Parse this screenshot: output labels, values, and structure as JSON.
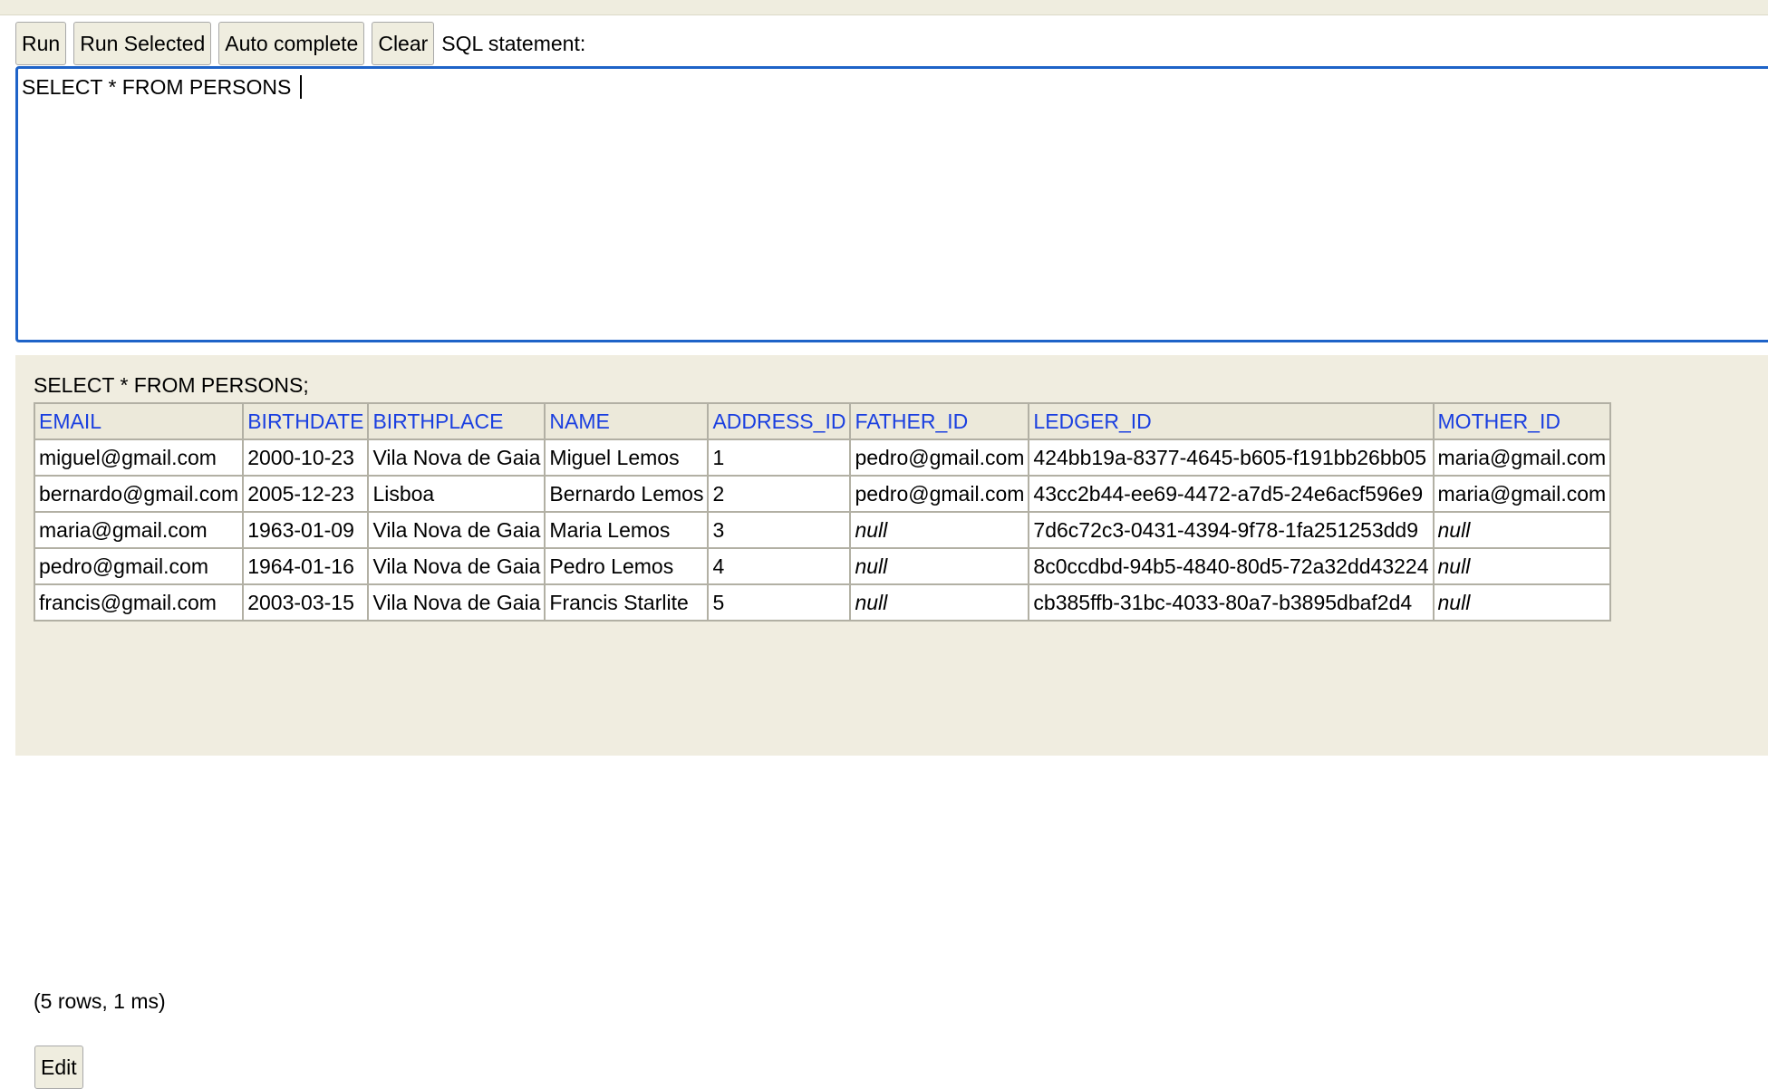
{
  "toolbar": {
    "run_label": "Run",
    "run_selected_label": "Run Selected",
    "auto_complete_label": "Auto complete",
    "clear_label": "Clear",
    "sql_statement_label": "SQL statement:"
  },
  "editor": {
    "value": "SELECT * FROM PERSONS "
  },
  "result": {
    "query_text": "SELECT * FROM PERSONS;",
    "columns": [
      "EMAIL",
      "BIRTHDATE",
      "BIRTHPLACE",
      "NAME",
      "ADDRESS_ID",
      "FATHER_ID",
      "LEDGER_ID",
      "MOTHER_ID"
    ],
    "rows": [
      [
        "miguel@gmail.com",
        "2000-10-23",
        "Vila Nova de Gaia",
        "Miguel Lemos",
        "1",
        "pedro@gmail.com",
        "424bb19a-8377-4645-b605-f191bb26bb05",
        "maria@gmail.com"
      ],
      [
        "bernardo@gmail.com",
        "2005-12-23",
        "Lisboa",
        "Bernardo Lemos",
        "2",
        "pedro@gmail.com",
        "43cc2b44-ee69-4472-a7d5-24e6acf596e9",
        "maria@gmail.com"
      ],
      [
        "maria@gmail.com",
        "1963-01-09",
        "Vila Nova de Gaia",
        "Maria Lemos",
        "3",
        "null",
        "7d6c72c3-0431-4394-9f78-1fa251253dd9",
        "null"
      ],
      [
        "pedro@gmail.com",
        "1964-01-16",
        "Vila Nova de Gaia",
        "Pedro Lemos",
        "4",
        "null",
        "8c0ccdbd-94b5-4840-80d5-72a32dd43224",
        "null"
      ],
      [
        "francis@gmail.com",
        "2003-03-15",
        "Vila Nova de Gaia",
        "Francis Starlite",
        "5",
        "null",
        "cb385ffb-31bc-4033-80a7-b3895dbaf2d4",
        "null"
      ]
    ],
    "summary": "(5 rows, 1 ms)",
    "edit_label": "Edit"
  },
  "colors": {
    "panel_bg": "#f0ede0",
    "header_text": "#1a3fe0",
    "editor_focus_border": "#1e63c8"
  }
}
